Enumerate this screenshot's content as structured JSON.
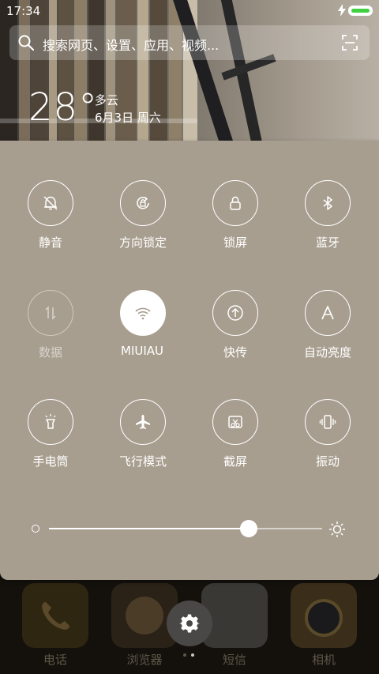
{
  "status_bar": {
    "time": "17:34",
    "battery_icon": "battery-icon",
    "charging_icon": "charging-icon",
    "battery_color": "#3fd13f"
  },
  "search": {
    "placeholder": "搜索网页、设置、应用、视频..."
  },
  "weather": {
    "temperature": "28°",
    "condition": "多云",
    "date": "6月3日 周六"
  },
  "quick_toggles": [
    {
      "label": "静音",
      "icon": "bell-off-icon",
      "state": "off"
    },
    {
      "label": "方向锁定",
      "icon": "rotation-lock-icon",
      "state": "off"
    },
    {
      "label": "锁屏",
      "icon": "lock-icon",
      "state": "off"
    },
    {
      "label": "蓝牙",
      "icon": "bluetooth-icon",
      "state": "off"
    },
    {
      "label": "数据",
      "icon": "mobile-data-icon",
      "state": "disabled"
    },
    {
      "label": "MIUIAU",
      "icon": "wifi-icon",
      "state": "on"
    },
    {
      "label": "快传",
      "icon": "quick-transfer-icon",
      "state": "off"
    },
    {
      "label": "自动亮度",
      "icon": "auto-brightness-icon",
      "state": "off"
    },
    {
      "label": "手电筒",
      "icon": "flashlight-icon",
      "state": "off"
    },
    {
      "label": "飞行模式",
      "icon": "airplane-icon",
      "state": "off"
    },
    {
      "label": "截屏",
      "icon": "screenshot-icon",
      "state": "off"
    },
    {
      "label": "振动",
      "icon": "vibrate-icon",
      "state": "off"
    }
  ],
  "brightness": {
    "level": 0.73
  },
  "dock": {
    "apps": [
      {
        "label": "电话",
        "icon": "phone-icon"
      },
      {
        "label": "浏览器",
        "icon": "browser-icon"
      },
      {
        "label": "短信",
        "icon": "message-icon"
      },
      {
        "label": "相机",
        "icon": "camera-icon"
      }
    ],
    "page_count": 2,
    "current_page": 2
  },
  "colors": {
    "panel": "#a89e8f",
    "active_tile": "#ffffff",
    "accent_battery": "#3fd13f"
  }
}
